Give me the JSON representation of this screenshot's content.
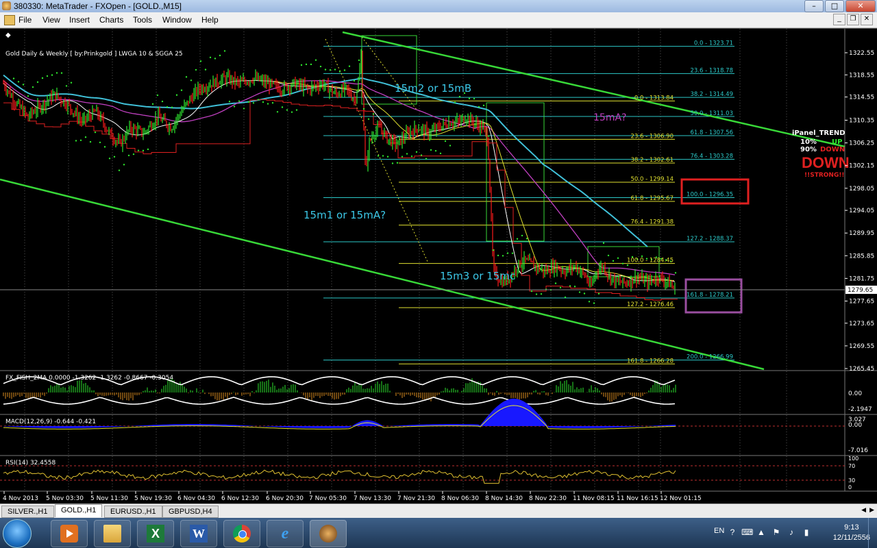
{
  "window": {
    "title": "380330: MetaTrader - FXOpen - [GOLD.,M15]",
    "minimize": "–",
    "maximize": "□",
    "close": "✕"
  },
  "menu": [
    "File",
    "View",
    "Insert",
    "Charts",
    "Tools",
    "Window",
    "Help"
  ],
  "mdi_buttons": [
    "_",
    "❐",
    "✕"
  ],
  "chart": {
    "header": "Gold Daily & Weekly [ by:Prinkgold ] LWGA 10  &  SGGA 25",
    "colors": {
      "bull": "#2ee82e",
      "bear": "#ff1a1a",
      "trend": "#38d838",
      "fib_cyan": "#2cc8c8",
      "fib_yellow": "#e0e030",
      "ma_cyan": "#40c0d8",
      "ma_magenta": "#c040c0"
    },
    "price_axis": [
      "1322.55",
      "1318.55",
      "1314.55",
      "1310.35",
      "1306.25",
      "1302.15",
      "1298.05",
      "1294.05",
      "1289.95",
      "1285.85",
      "1281.75",
      "1277.65",
      "1273.65",
      "1269.55",
      "1265.45"
    ],
    "current_price": "1279.65",
    "annotations": [
      {
        "text": "15m2 or 15mB",
        "color": "#3cc8e8"
      },
      {
        "text": "15mA?",
        "color": "#c040c0"
      },
      {
        "text": "15m1 or 15mA?",
        "color": "#3cc8e8"
      },
      {
        "text": "15m3 or 15mc",
        "color": "#3cc8e8"
      }
    ],
    "fib_labels": [
      {
        "text": "0.0 - 1323.71",
        "color": "#2cc8c8"
      },
      {
        "text": "23.6 - 1318.78",
        "color": "#2cc8c8"
      },
      {
        "text": "38.2 - 1314.49",
        "color": "#2cc8c8"
      },
      {
        "text": "0.0 - 1313.84",
        "color": "#e0e030"
      },
      {
        "text": "50.0 - 1311.03",
        "color": "#2cc8c8"
      },
      {
        "text": "23.6 - 1306.90",
        "color": "#e0e030"
      },
      {
        "text": "61.8 - 1307.56",
        "color": "#2cc8c8"
      },
      {
        "text": "76.4 - 1303.28",
        "color": "#2cc8c8"
      },
      {
        "text": "38.2 - 1302.61",
        "color": "#e0e030"
      },
      {
        "text": "50.0 - 1299.14",
        "color": "#e0e030"
      },
      {
        "text": "100.0 - 1296.35",
        "color": "#2cc8c8"
      },
      {
        "text": "61.8 - 1295.67",
        "color": "#e0e030"
      },
      {
        "text": "76.4 - 1291.38",
        "color": "#e0e030"
      },
      {
        "text": "127.2 - 1288.37",
        "color": "#2cc8c8"
      },
      {
        "text": "100.0 - 1284.45",
        "color": "#e0e030"
      },
      {
        "text": "161.8 - 1278.21",
        "color": "#2cc8c8"
      },
      {
        "text": "127.2 - 1276.46",
        "color": "#e0e030"
      },
      {
        "text": "161.8 - 1266.28",
        "color": "#e0e030"
      },
      {
        "text": "200.0 - 1266.99",
        "color": "#2cc8c8"
      }
    ],
    "ipanel": {
      "title": "iPanel_TREND",
      "pct_up": "10%",
      "up": "UP",
      "pct_down": "90%",
      "down": "DOWN",
      "big": "DOWN",
      "strong": "!!STRONG!!"
    }
  },
  "fisher": {
    "label": "FX_FISH_2MA 0.0000 -1.3262 -1.3262 -0.8667 -0.3054",
    "scale": [
      "0.00",
      "-2.1947"
    ]
  },
  "macd": {
    "label": "MACD(12,26,9) -0.644 -0.421",
    "scale": [
      "3.027",
      "0.00",
      "-7.016"
    ]
  },
  "rsi": {
    "label": "RSI(14) 32.4558",
    "scale": [
      "100",
      "70",
      "30",
      "0"
    ]
  },
  "time_axis": [
    "4 Nov 2013",
    "5 Nov 03:30",
    "5 Nov 11:30",
    "5 Nov 19:30",
    "6 Nov 04:30",
    "6 Nov 12:30",
    "6 Nov 20:30",
    "7 Nov 05:30",
    "7 Nov 13:30",
    "7 Nov 21:30",
    "8 Nov 06:30",
    "8 Nov 14:30",
    "8 Nov 22:30",
    "11 Nov 08:15",
    "11 Nov 16:15",
    "12 Nov 01:15"
  ],
  "tabs": [
    {
      "label": "SILVER.,H1",
      "active": false
    },
    {
      "label": "GOLD.,H1",
      "active": true
    },
    {
      "label": "EURUSD.,H1",
      "active": false
    },
    {
      "label": "GBPUSD,H4",
      "active": false
    }
  ],
  "taskbar": {
    "apps": [
      "media-player",
      "file-explorer",
      "excel",
      "word",
      "chrome",
      "internet-explorer",
      "metatrader"
    ],
    "language": "EN",
    "time": "9:13",
    "date": "12/11/2556"
  }
}
